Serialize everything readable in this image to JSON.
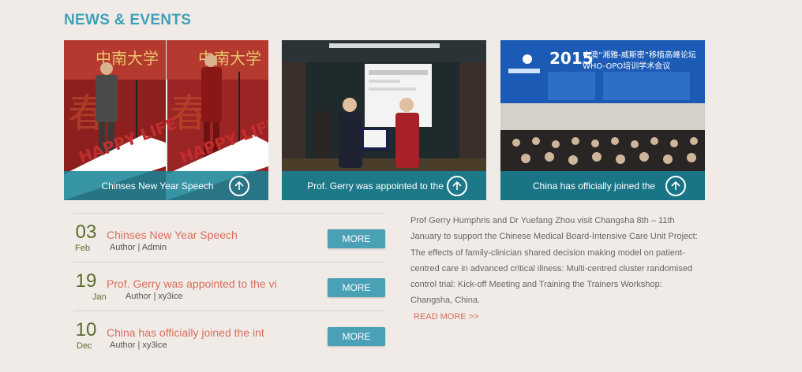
{
  "section": {
    "title": "NEWS & EVENTS"
  },
  "featured": [
    {
      "caption": "Chinses New Year Speech",
      "banner_text": "HAPPY LIFE",
      "photo": "speakers-at-new-year-stage",
      "accent": "#c22d2d"
    },
    {
      "caption": "Prof. Gerry was appointed to the",
      "photo": "certificate-presentation-photo",
      "accent": "#2c3c3f"
    },
    {
      "caption": "China has officially joined the",
      "banner_year": "2015",
      "banner_cn": "中澳“湘雅-威斯密”移植高峰论坛",
      "banner_sub": "WHO-OPO培训学术会议",
      "photo": "conference-audience-photo",
      "accent": "#1a4fa0"
    }
  ],
  "news": [
    {
      "day": "03",
      "month": "Feb",
      "headline": "Chinses New Year Speech",
      "meta": "Author | Admin",
      "button": "MORE"
    },
    {
      "day": "19",
      "month": "Jan",
      "headline": "Prof. Gerry was appointed to the vi",
      "meta": "Author | xy3ice",
      "button": "MORE"
    },
    {
      "day": "10",
      "month": "Dec",
      "headline": "China has officially joined the int",
      "meta": "Author | xy3ice",
      "button": "MORE"
    }
  ],
  "summary": {
    "text": "Prof Gerry Humphris and Dr Yuefang Zhou visit Changsha 8th – 11th January to support the Chinese Medical Board-Intensive Care Unit Project: The effects of family-clinician shared decision making model on patient-centred care in advanced critical illness: Multi-centred cluster randomised control trial: Kick-off Meeting and Training the Trainers Workshop: Changsha, China.",
    "read_more": "READ MORE >>"
  },
  "colors": {
    "accent": "#3fa0b8",
    "headline": "#d86e5c",
    "date": "#5b6d2a",
    "button": "#4aa0b5",
    "background": "#f1ebe7"
  }
}
